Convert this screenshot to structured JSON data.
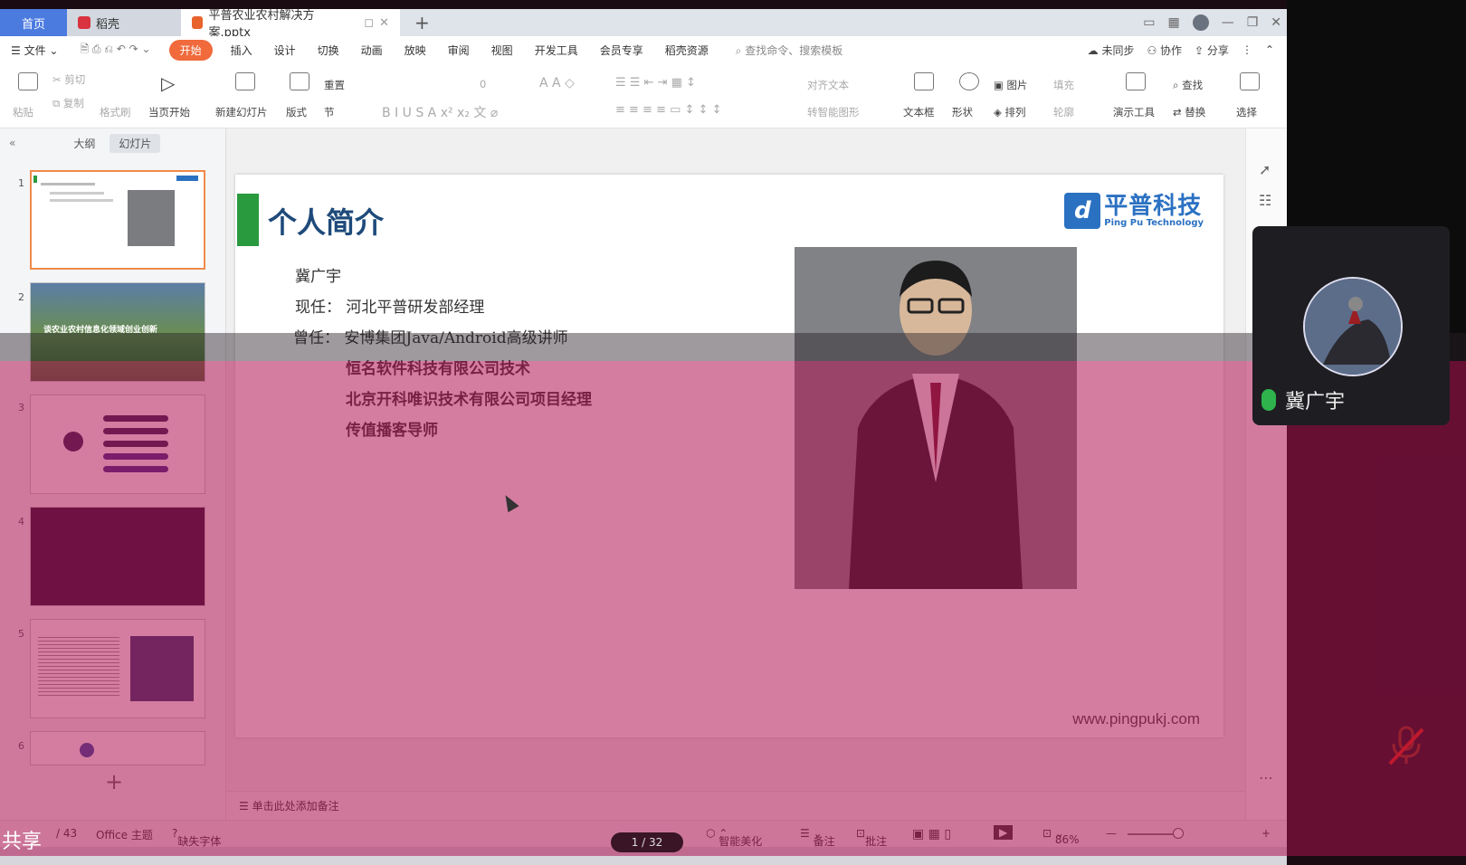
{
  "tabs": {
    "home": "首页",
    "docer": "稻壳",
    "document": "平普农业农村解决方案.pptx",
    "new_tab": "+"
  },
  "menu": {
    "file": "文件",
    "items": [
      "开始",
      "插入",
      "设计",
      "切换",
      "动画",
      "放映",
      "审阅",
      "视图",
      "开发工具",
      "会员专享",
      "稻壳资源"
    ],
    "search": "查找命令、搜索模板",
    "sync": "未同步",
    "collab": "协作",
    "share": "分享"
  },
  "ribbon": {
    "paste": "粘贴",
    "cut": "剪切",
    "copy": "复制",
    "format_painter": "格式刷",
    "play_from_current": "当页开始",
    "new_slide": "新建幻灯片",
    "layout": "版式",
    "section": "节",
    "reset": "重置",
    "font_size": "0",
    "text_align": "对齐文本",
    "smart_convert": "转智能图形",
    "textbox": "文本框",
    "shape": "形状",
    "picture": "图片",
    "fill": "填充",
    "arrange": "排列",
    "outline": "轮廓",
    "present_tools": "演示工具",
    "find": "查找",
    "replace": "替换",
    "select": "选择"
  },
  "left_pane": {
    "tab_outline": "大纲",
    "tab_slides": "幻灯片",
    "slide_numbers": [
      "1",
      "2",
      "3",
      "4",
      "5",
      "6"
    ],
    "slide2_title": "谈农业农村信息化领域创业创新",
    "add": "+"
  },
  "slide": {
    "title": "个人简介",
    "logo_cn": "平普科技",
    "logo_en": "Ping Pu Technology",
    "name": "冀广宇",
    "current_label": "现任：",
    "current": "河北平普研发部经理",
    "former_label": "曾任：",
    "former": [
      "安博集团Java/Android高级讲师",
      "恒名软件科技有限公司技术",
      "北京开科唯识技术有限公司项目经理",
      "传值播客导师"
    ],
    "website": "www.pingpukj.com"
  },
  "notes": "单击此处添加备注",
  "status": {
    "page": "/ 43",
    "theme": "Office 主题",
    "missing_font": "缺失字体",
    "beautify": "智能美化",
    "notes": "备注",
    "comments": "批注",
    "zoom": "86%"
  },
  "share_label": "共享",
  "pager": "1 / 32",
  "call": {
    "participant": "冀广宇"
  },
  "colors": {
    "accent": "#4c7be0",
    "start_tab": "#f06a3c",
    "title_blue": "#1e4a7a",
    "title_bar_green": "#2a9a3f",
    "overlay": "#b01254",
    "mic_on": "#2fb34c",
    "mute": "#c0182e"
  }
}
